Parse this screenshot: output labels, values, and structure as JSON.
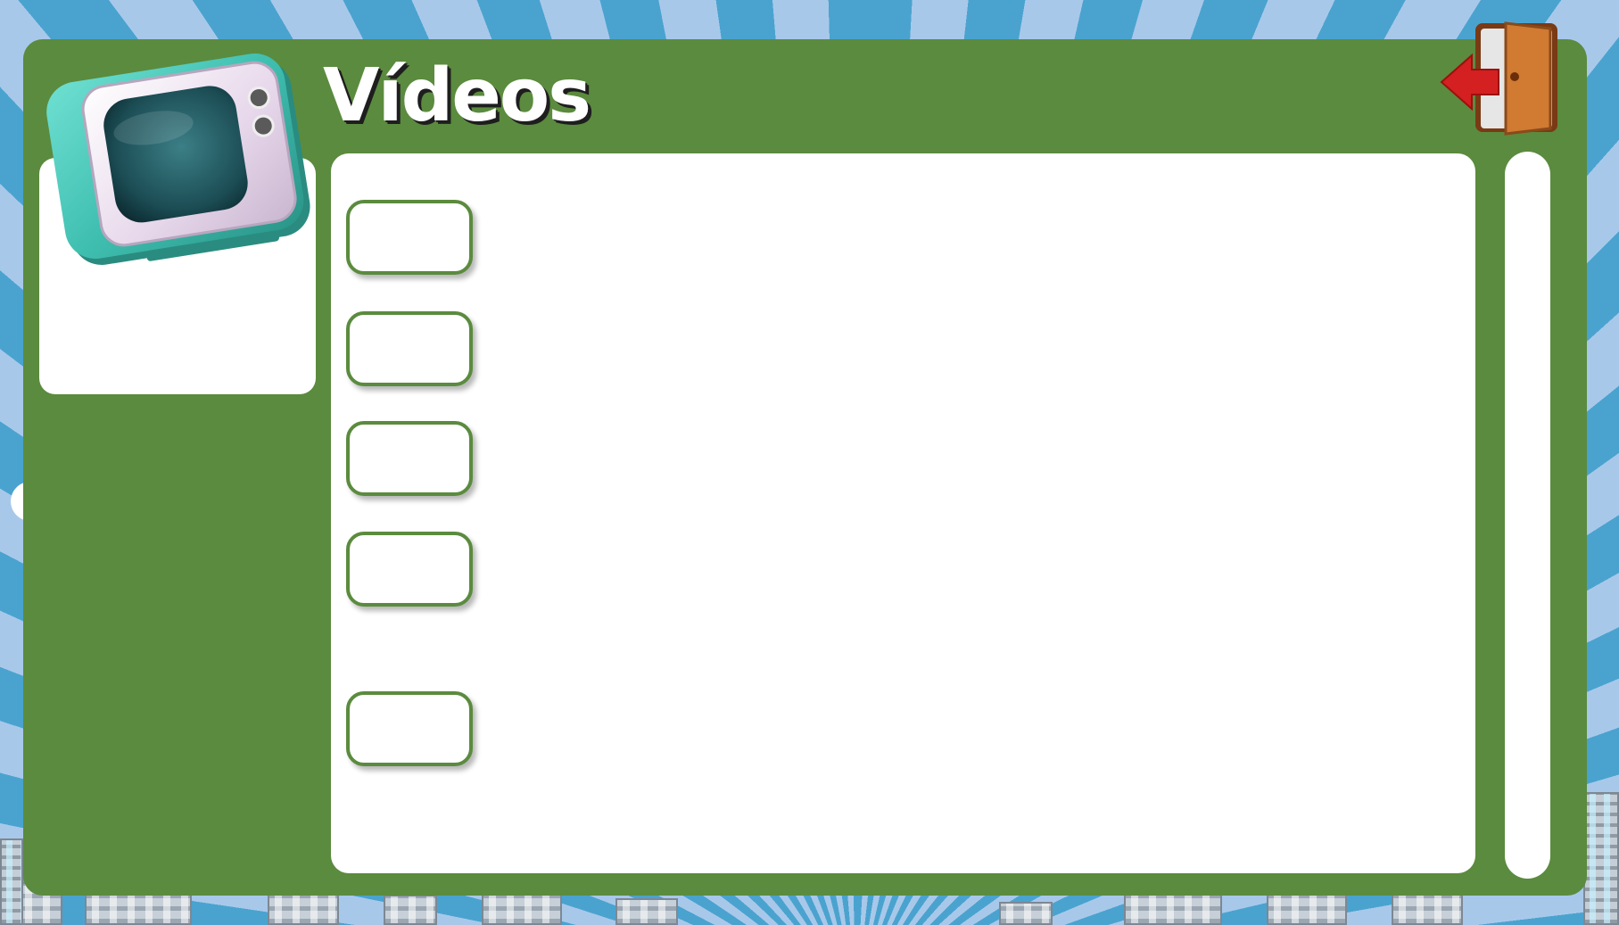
{
  "header": {
    "title": "Vídeos",
    "exit_icon": "exit-door-arrow-icon",
    "tv_icon": "retro-tv-icon"
  },
  "video_list": {
    "items": [
      {
        "label": ""
      },
      {
        "label": ""
      },
      {
        "label": ""
      },
      {
        "label": ""
      },
      {
        "label": ""
      }
    ]
  },
  "colors": {
    "panel_green": "#5b8b3e",
    "sky_blue_dark": "#4aa3cf",
    "sky_blue_light": "#a8c8ea",
    "exit_arrow_red": "#d42020",
    "door_brown": "#c06a2a",
    "tv_teal": "#3fbfb0"
  }
}
